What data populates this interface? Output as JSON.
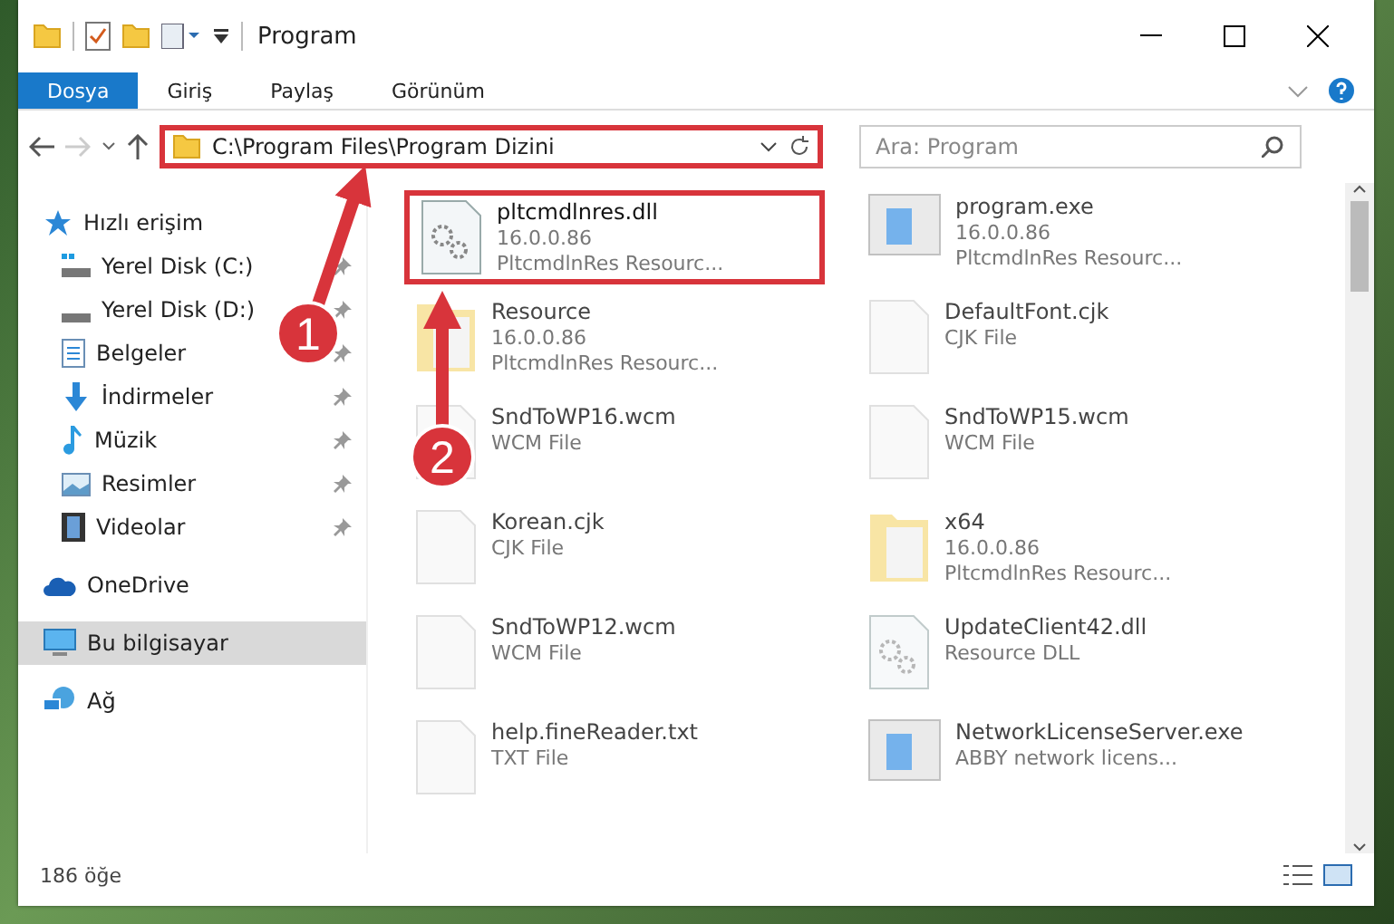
{
  "window": {
    "title": "Program"
  },
  "ribbon_tabs": [
    {
      "label": "Dosya",
      "selected": true
    },
    {
      "label": "Giriş",
      "selected": false
    },
    {
      "label": "Paylaş",
      "selected": false
    },
    {
      "label": "Görünüm",
      "selected": false
    }
  ],
  "address_bar": {
    "path": "C:\\Program Files\\Program Dizini",
    "highlighted": true
  },
  "search": {
    "placeholder": "Ara: Program"
  },
  "sidebar": {
    "items": [
      {
        "label": "Hızlı erişim",
        "pinned": false,
        "selected": false,
        "children": [
          {
            "label": "Yerel Disk (C:)",
            "pinned": true,
            "selected": false
          },
          {
            "label": "Yerel Disk (D:)",
            "pinned": true,
            "selected": false
          },
          {
            "label": "Belgeler",
            "pinned": true,
            "selected": false
          },
          {
            "label": "İndirmeler",
            "pinned": true,
            "selected": false
          },
          {
            "label": "Müzik",
            "pinned": true,
            "selected": false
          },
          {
            "label": "Resimler",
            "pinned": true,
            "selected": false
          },
          {
            "label": "Videolar",
            "pinned": true,
            "selected": false
          }
        ]
      },
      {
        "label": "OneDrive",
        "pinned": false,
        "selected": false
      },
      {
        "label": "Bu bilgisayar",
        "pinned": false,
        "selected": true
      },
      {
        "label": "Ağ",
        "pinned": false,
        "selected": false
      }
    ]
  },
  "files": [
    {
      "kind": "gear",
      "name": "pltcmdlnres.dll",
      "lines": [
        "16.0.0.86",
        "PltcmdlnRes Resourc..."
      ],
      "highlighted": true,
      "blurred": false
    },
    {
      "kind": "app",
      "name": "program.exe",
      "lines": [
        "16.0.0.86",
        "PltcmdlnRes Resourc..."
      ],
      "highlighted": false,
      "blurred": true
    },
    {
      "kind": "folder",
      "name": "Resource",
      "lines": [
        "16.0.0.86",
        "PltcmdlnRes Resourc..."
      ],
      "highlighted": false,
      "blurred": true
    },
    {
      "kind": "doc",
      "name": "DefaultFont.cjk",
      "lines": [
        "CJK File"
      ],
      "highlighted": false,
      "blurred": true
    },
    {
      "kind": "doc",
      "name": "SndToWP16.wcm",
      "lines": [
        "WCM File"
      ],
      "highlighted": false,
      "blurred": true
    },
    {
      "kind": "doc",
      "name": "SndToWP15.wcm",
      "lines": [
        "WCM File"
      ],
      "highlighted": false,
      "blurred": true
    },
    {
      "kind": "doc",
      "name": "Korean.cjk",
      "lines": [
        "CJK File"
      ],
      "highlighted": false,
      "blurred": true
    },
    {
      "kind": "folder",
      "name": "x64",
      "lines": [
        "16.0.0.86",
        "PltcmdlnRes Resourc..."
      ],
      "highlighted": false,
      "blurred": true
    },
    {
      "kind": "doc",
      "name": "SndToWP12.wcm",
      "lines": [
        "WCM File"
      ],
      "highlighted": false,
      "blurred": true
    },
    {
      "kind": "gear",
      "name": "UpdateClient42.dll",
      "lines": [
        "Resource DLL"
      ],
      "highlighted": false,
      "blurred": true
    },
    {
      "kind": "doc",
      "name": "help.fineReader.txt",
      "lines": [
        "TXT File"
      ],
      "highlighted": false,
      "blurred": true
    },
    {
      "kind": "app",
      "name": "NetworkLicenseServer.exe",
      "lines": [
        "ABBY network licens..."
      ],
      "highlighted": false,
      "blurred": true
    }
  ],
  "status_bar": {
    "count": "186 öğe"
  },
  "callouts": [
    {
      "label": "1"
    },
    {
      "label": "2"
    }
  ]
}
